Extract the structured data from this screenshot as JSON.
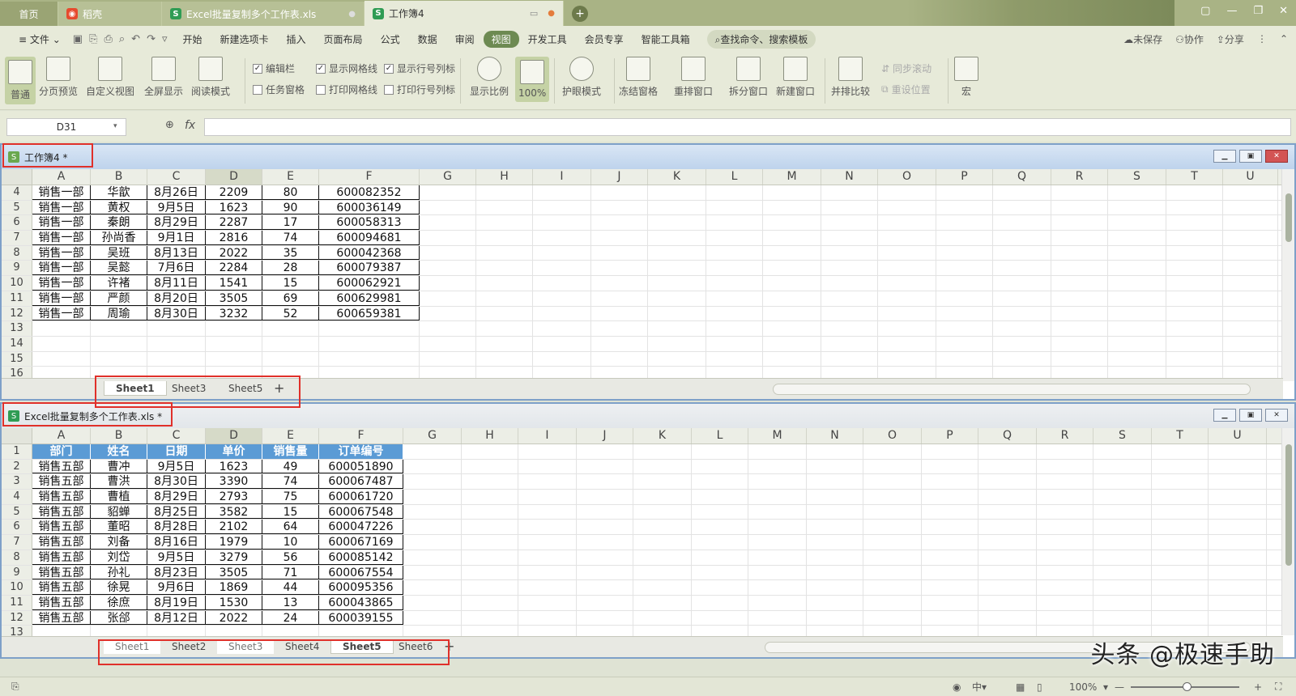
{
  "tabs": {
    "home": "首页",
    "doc": "稻壳",
    "xls": "Excel批量复制多个工作表.xls",
    "active": "工作簿4"
  },
  "menu": {
    "file": "文件",
    "items": [
      "开始",
      "新建选项卡",
      "插入",
      "页面布局",
      "公式",
      "数据",
      "审阅",
      "视图",
      "开发工具",
      "会员专享",
      "智能工具箱"
    ],
    "active_item": "视图",
    "search": "查找命令、搜索模板",
    "unsaved": "未保存",
    "collab": "协作",
    "share": "分享"
  },
  "ribbon": {
    "normal": "普通",
    "page_preview": "分页预览",
    "custom_view": "自定义视图",
    "fullscreen": "全屏显示",
    "reading": "阅读模式",
    "edit_bar": "编辑栏",
    "task_pane": "任务窗格",
    "show_grid": "显示网格线",
    "print_grid": "打印网格线",
    "show_headers": "显示行号列标",
    "print_headers": "打印行号列标",
    "zoom": "显示比例",
    "zoom100": "100%",
    "eye": "护眼模式",
    "freeze": "冻结窗格",
    "arrange": "重排窗口",
    "split": "拆分窗口",
    "new_window": "新建窗口",
    "side_by_side": "并排比较",
    "sync_scroll": "同步滚动",
    "reset_pos": "重设位置",
    "macro": "宏"
  },
  "formula": {
    "namebox": "D31",
    "fx": "fx",
    "content": ""
  },
  "window1": {
    "title": "工作簿4 *",
    "columns": [
      "A",
      "B",
      "C",
      "D",
      "E",
      "F",
      "G",
      "H",
      "I",
      "J",
      "K",
      "L",
      "M",
      "N",
      "O",
      "P",
      "Q",
      "R",
      "S",
      "T",
      "U"
    ],
    "rows": [
      {
        "n": "4",
        "cells": [
          "销售一部",
          "华歆",
          "8月26日",
          "2209",
          "80",
          "600082352"
        ]
      },
      {
        "n": "5",
        "cells": [
          "销售一部",
          "黄权",
          "9月5日",
          "1623",
          "90",
          "600036149"
        ]
      },
      {
        "n": "6",
        "cells": [
          "销售一部",
          "秦朗",
          "8月29日",
          "2287",
          "17",
          "600058313"
        ]
      },
      {
        "n": "7",
        "cells": [
          "销售一部",
          "孙尚香",
          "9月1日",
          "2816",
          "74",
          "600094681"
        ]
      },
      {
        "n": "8",
        "cells": [
          "销售一部",
          "吴班",
          "8月13日",
          "2022",
          "35",
          "600042368"
        ]
      },
      {
        "n": "9",
        "cells": [
          "销售一部",
          "吴懿",
          "7月6日",
          "2284",
          "28",
          "600079387"
        ]
      },
      {
        "n": "10",
        "cells": [
          "销售一部",
          "许褚",
          "8月11日",
          "1541",
          "15",
          "600062921"
        ]
      },
      {
        "n": "11",
        "cells": [
          "销售一部",
          "严颜",
          "8月20日",
          "3505",
          "69",
          "600629981"
        ]
      },
      {
        "n": "12",
        "cells": [
          "销售一部",
          "周瑜",
          "8月30日",
          "3232",
          "52",
          "600659381"
        ]
      },
      {
        "n": "13",
        "cells": [
          "",
          "",
          "",
          "",
          "",
          ""
        ]
      },
      {
        "n": "14",
        "cells": [
          "",
          "",
          "",
          "",
          "",
          ""
        ]
      },
      {
        "n": "15",
        "cells": [
          "",
          "",
          "",
          "",
          "",
          ""
        ]
      },
      {
        "n": "16",
        "cells": [
          "",
          "",
          "",
          "",
          "",
          ""
        ]
      }
    ],
    "sheets": [
      "Sheet1",
      "Sheet3",
      "Sheet5"
    ],
    "active_sheet": "Sheet1"
  },
  "window2": {
    "title": "Excel批量复制多个工作表.xls *",
    "header_row": [
      "部门",
      "姓名",
      "日期",
      "单价",
      "销售量",
      "订单编号"
    ],
    "rows": [
      {
        "n": "2",
        "cells": [
          "销售五部",
          "曹冲",
          "9月5日",
          "1623",
          "49",
          "600051890"
        ]
      },
      {
        "n": "3",
        "cells": [
          "销售五部",
          "曹洪",
          "8月30日",
          "3390",
          "74",
          "600067487"
        ]
      },
      {
        "n": "4",
        "cells": [
          "销售五部",
          "曹植",
          "8月29日",
          "2793",
          "75",
          "600061720"
        ]
      },
      {
        "n": "5",
        "cells": [
          "销售五部",
          "貂蝉",
          "8月25日",
          "3582",
          "15",
          "600067548"
        ]
      },
      {
        "n": "6",
        "cells": [
          "销售五部",
          "董昭",
          "8月28日",
          "2102",
          "64",
          "600047226"
        ]
      },
      {
        "n": "7",
        "cells": [
          "销售五部",
          "刘备",
          "8月16日",
          "1979",
          "10",
          "600067169"
        ]
      },
      {
        "n": "8",
        "cells": [
          "销售五部",
          "刘岱",
          "9月5日",
          "3279",
          "56",
          "600085142"
        ]
      },
      {
        "n": "9",
        "cells": [
          "销售五部",
          "孙礼",
          "8月23日",
          "3505",
          "71",
          "600067554"
        ]
      },
      {
        "n": "10",
        "cells": [
          "销售五部",
          "徐晃",
          "9月6日",
          "1869",
          "44",
          "600095356"
        ]
      },
      {
        "n": "11",
        "cells": [
          "销售五部",
          "徐庶",
          "8月19日",
          "1530",
          "13",
          "600043865"
        ]
      },
      {
        "n": "12",
        "cells": [
          "销售五部",
          "张郃",
          "8月12日",
          "2022",
          "24",
          "600039155"
        ]
      },
      {
        "n": "13",
        "cells": [
          "",
          "",
          "",
          "",
          "",
          ""
        ]
      }
    ],
    "sheets": [
      "Sheet1",
      "Sheet2",
      "Sheet3",
      "Sheet4",
      "Sheet5",
      "Sheet6"
    ],
    "active_sheet": "Sheet5"
  },
  "status": {
    "zoom": "100%"
  },
  "watermark": "头条 @极速手助"
}
